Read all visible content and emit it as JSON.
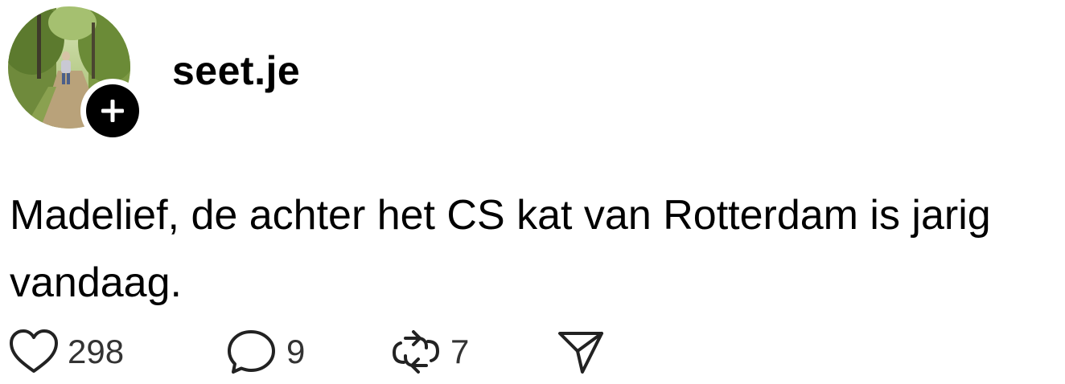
{
  "post": {
    "author": {
      "username": "seet.je",
      "avatar_icon": "avatar-photo-forest-path",
      "follow_icon": "plus-icon"
    },
    "text": "Madelief, de achter het CS kat van Rotterdam is jarig vandaag.",
    "actions": {
      "likes": "298",
      "replies": "9",
      "reposts": "7",
      "like_icon": "heart-icon",
      "reply_icon": "speech-bubble-icon",
      "repost_icon": "repost-icon",
      "share_icon": "paper-plane-icon"
    }
  },
  "colors": {
    "text": "#000000",
    "counts": "#333333",
    "badge": "#000000",
    "background": "#ffffff"
  }
}
